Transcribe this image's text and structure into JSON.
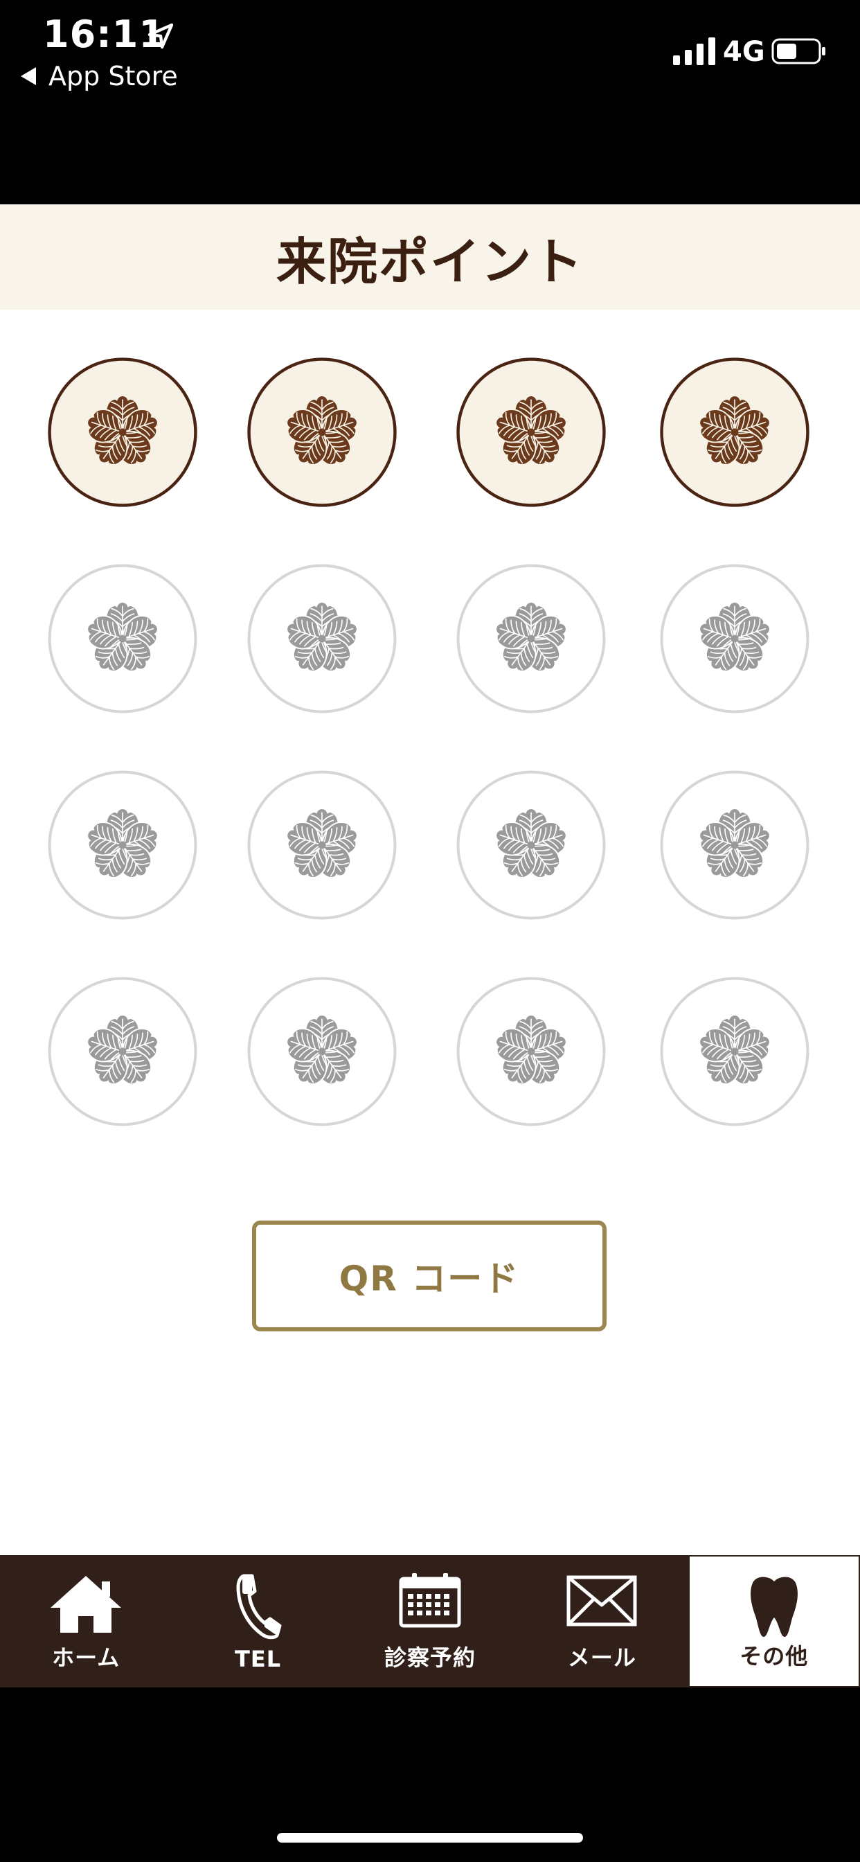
{
  "status_bar": {
    "time": "16:11",
    "back_label": "App Store",
    "network": "4G",
    "battery_level": 0.5
  },
  "header": {
    "title": "来院ポイント"
  },
  "stamp_card": {
    "total_slots": 16,
    "collected": 4,
    "icon": "paulownia-crest-icon",
    "colors": {
      "collected_fill": "#f8f2e6",
      "collected_ring": "#4a2412",
      "collected_crest": "#6b3a1c",
      "empty_ring": "#d6d6d6",
      "empty_crest": "#9a9a9a"
    }
  },
  "qr_button": {
    "label": "QR コード"
  },
  "tab_bar": {
    "tabs": [
      {
        "label": "ホーム",
        "icon": "home-icon",
        "active": false
      },
      {
        "label": "TEL",
        "icon": "phone-icon",
        "active": false
      },
      {
        "label": "診察予約",
        "icon": "calendar-icon",
        "active": false
      },
      {
        "label": "メール",
        "icon": "mail-icon",
        "active": false
      },
      {
        "label": "その他",
        "icon": "tooth-icon",
        "active": true
      }
    ]
  },
  "colors": {
    "header_bg": "#f8f4ea",
    "title_text": "#3b1f10",
    "qr_border": "#9c8650",
    "tab_bar_bg": "#302019"
  }
}
